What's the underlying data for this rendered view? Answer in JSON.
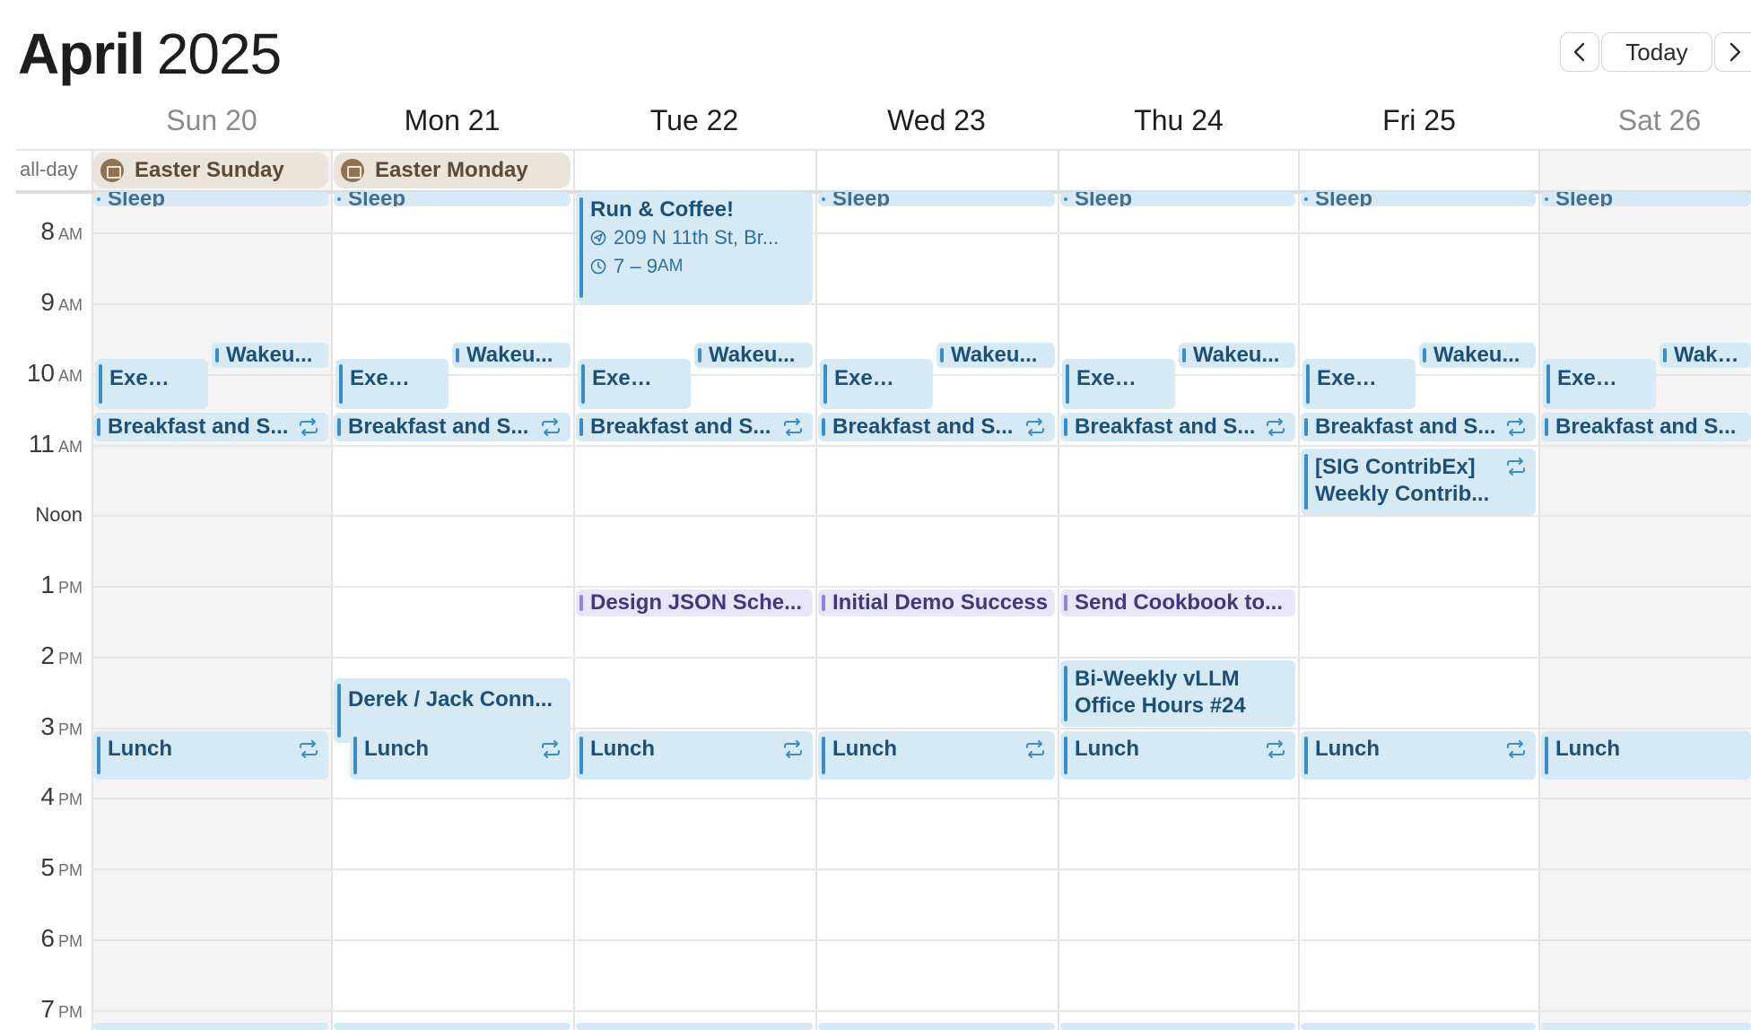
{
  "header": {
    "month": "April",
    "year": "2025"
  },
  "nav": {
    "prev_icon": "chevron-left-icon",
    "today_label": "Today",
    "next_icon": "chevron-right-icon"
  },
  "days": [
    "Sun 20",
    "Mon 21",
    "Tue 22",
    "Wed 23",
    "Thu 24",
    "Fri 25",
    "Sat 26"
  ],
  "allday": {
    "label": "all-day",
    "events": [
      "Easter Sunday",
      "Easter Monday"
    ],
    "holiday_color": "#8e7352"
  },
  "times": {
    "t8": "8",
    "t9": "9",
    "t10": "10",
    "t11": "11",
    "t1": "1",
    "t2": "2",
    "t3": "3",
    "t4": "4",
    "t5": "5",
    "t6": "6",
    "t7": "7",
    "am": "AM",
    "pm": "PM",
    "noon": "Noon"
  },
  "events": {
    "sleep": "Sleep",
    "run": {
      "title": "Run & Coffee!",
      "location": "209 N 11th St, Br...",
      "time_range": "7 – 9",
      "time_suffix": "AM"
    },
    "wakeup": "Wakeu...",
    "wakeup_sat": "Wakeu.",
    "exercise": "Exercise",
    "breakfast": "Breakfast and S...",
    "sig": "[SIG ContribEx] Weekly Contrib...",
    "design": "Design JSON Sche...",
    "demo": "Initial Demo Success",
    "cookbook": "Send Cookbook to...",
    "derek": "Derek / Jack Conn...",
    "vllm": "Bi-Weekly vLLM Office Hours #24",
    "lunch": "Lunch"
  },
  "colors": {
    "event_blue": "#d6eaf6",
    "event_blue_bar": "#3a8ccb",
    "event_purple": "#e9e6fb",
    "event_purple_bar": "#8c84e0",
    "weekend_bg": "#f4f4f5"
  }
}
